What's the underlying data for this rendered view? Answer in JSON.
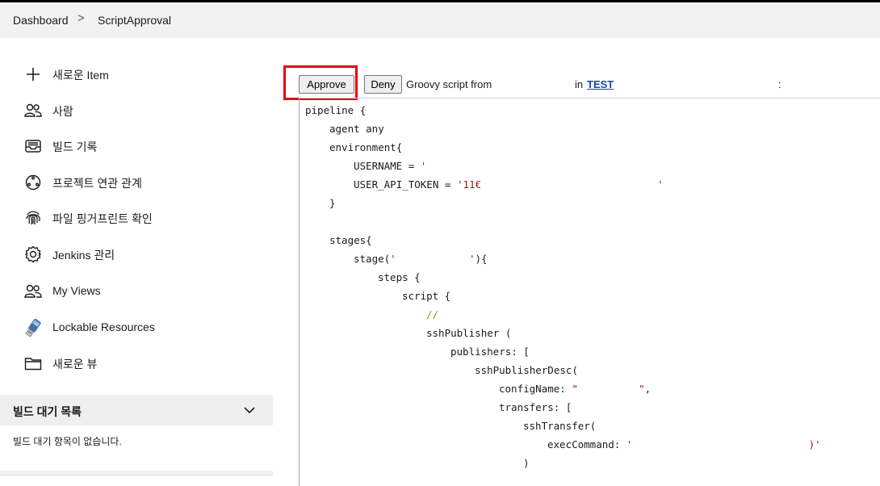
{
  "breadcrumb": {
    "items": [
      "Dashboard",
      "ScriptApproval"
    ],
    "separator": ">"
  },
  "sidebar": {
    "items": [
      {
        "label": "새로운 Item",
        "icon": "plus-icon"
      },
      {
        "label": "사람",
        "icon": "people-icon"
      },
      {
        "label": "빌드 기록",
        "icon": "inbox-icon"
      },
      {
        "label": "프로젝트 연관 관계",
        "icon": "relationship-icon"
      },
      {
        "label": "파일 핑거프린트 확인",
        "icon": "fingerprint-icon"
      },
      {
        "label": "Jenkins 관리",
        "icon": "gear-icon"
      },
      {
        "label": "My Views",
        "icon": "people-icon"
      },
      {
        "label": "Lockable Resources",
        "icon": "usb-drive-icon"
      },
      {
        "label": "새로운 뷰",
        "icon": "folder-icon"
      }
    ]
  },
  "build_queue": {
    "title": "빌드 대기 목록",
    "empty_text": "빌드 대기 항목이 없습니다."
  },
  "approval": {
    "approve_label": "Approve",
    "deny_label": "Deny",
    "from_text": "Groovy script from",
    "in_text": "in",
    "job_link": "TEST",
    "colon": ":"
  },
  "script": {
    "lines": [
      {
        "indent": 0,
        "parts": [
          {
            "t": "pipeline {"
          }
        ]
      },
      {
        "indent": 1,
        "parts": [
          {
            "t": "agent any"
          }
        ]
      },
      {
        "indent": 1,
        "parts": [
          {
            "t": "environment{"
          }
        ]
      },
      {
        "indent": 2,
        "parts": [
          {
            "t": "USERNAME = "
          },
          {
            "t": "'",
            "c": "str"
          }
        ]
      },
      {
        "indent": 2,
        "parts": [
          {
            "t": "USER_API_TOKEN = "
          },
          {
            "t": "'11€",
            "c": "str"
          },
          {
            "t": "                             "
          },
          {
            "t": "'",
            "c": "str"
          }
        ]
      },
      {
        "indent": 1,
        "parts": [
          {
            "t": "}"
          }
        ]
      },
      {
        "indent": 0,
        "parts": [
          {
            "t": ""
          }
        ]
      },
      {
        "indent": 1,
        "parts": [
          {
            "t": "stages{"
          }
        ]
      },
      {
        "indent": 2,
        "parts": [
          {
            "t": "stage("
          },
          {
            "t": "'            '",
            "c": "str"
          },
          {
            "t": "){"
          }
        ]
      },
      {
        "indent": 3,
        "parts": [
          {
            "t": "steps {"
          }
        ]
      },
      {
        "indent": 4,
        "parts": [
          {
            "t": "script {"
          }
        ]
      },
      {
        "indent": 5,
        "parts": [
          {
            "t": "//",
            "c": "cmt"
          }
        ]
      },
      {
        "indent": 5,
        "parts": [
          {
            "t": "sshPublisher ("
          }
        ]
      },
      {
        "indent": 6,
        "parts": [
          {
            "t": "publishers: ["
          }
        ]
      },
      {
        "indent": 7,
        "parts": [
          {
            "t": "sshPublisherDesc("
          }
        ]
      },
      {
        "indent": 8,
        "parts": [
          {
            "t": "configName: "
          },
          {
            "t": "\"          \"",
            "c": "str"
          },
          {
            "t": ","
          }
        ]
      },
      {
        "indent": 8,
        "parts": [
          {
            "t": "transfers: ["
          }
        ]
      },
      {
        "indent": 9,
        "parts": [
          {
            "t": "sshTransfer("
          }
        ]
      },
      {
        "indent": 10,
        "parts": [
          {
            "t": "execCommand: "
          },
          {
            "t": "'",
            "c": "str"
          },
          {
            "t": "                             "
          },
          {
            "t": ")'",
            "c": "str"
          }
        ]
      },
      {
        "indent": 9,
        "parts": [
          {
            "t": ")"
          }
        ]
      }
    ]
  },
  "colors": {
    "highlight_outline": "#e60012",
    "link": "#1a46a8",
    "string": "#a31515",
    "comment": "#b28c00"
  }
}
